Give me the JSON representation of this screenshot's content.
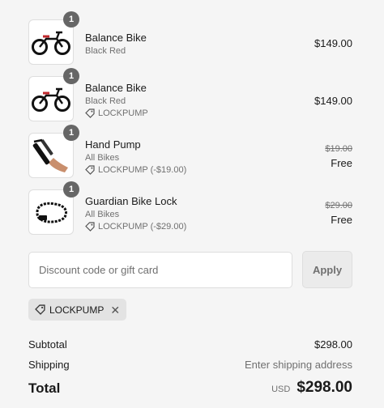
{
  "items": [
    {
      "name": "Balance Bike",
      "variant": "Black Red",
      "discount": "",
      "original_price": "",
      "price": "$149.00",
      "quantity": "1",
      "icon": "balance-bike-icon"
    },
    {
      "name": "Balance Bike",
      "variant": "Black Red",
      "discount": "LOCKPUMP",
      "original_price": "",
      "price": "$149.00",
      "quantity": "1",
      "icon": "balance-bike-icon"
    },
    {
      "name": "Hand Pump",
      "variant": "All Bikes",
      "discount": "LOCKPUMP (-$19.00)",
      "original_price": "$19.00",
      "price": "Free",
      "quantity": "1",
      "icon": "hand-pump-icon"
    },
    {
      "name": "Guardian Bike Lock",
      "variant": "All Bikes",
      "discount": "LOCKPUMP (-$29.00)",
      "original_price": "$29.00",
      "price": "Free",
      "quantity": "1",
      "icon": "bike-lock-icon"
    }
  ],
  "discount_form": {
    "placeholder": "Discount code or gift card",
    "value": "",
    "apply_label": "Apply"
  },
  "applied_code": {
    "label": "LOCKPUMP",
    "remove_icon": "close-icon"
  },
  "summary": {
    "subtotal_label": "Subtotal",
    "subtotal_value": "$298.00",
    "shipping_label": "Shipping",
    "shipping_value": "Enter shipping address",
    "total_label": "Total",
    "currency": "USD",
    "total_value": "$298.00"
  }
}
